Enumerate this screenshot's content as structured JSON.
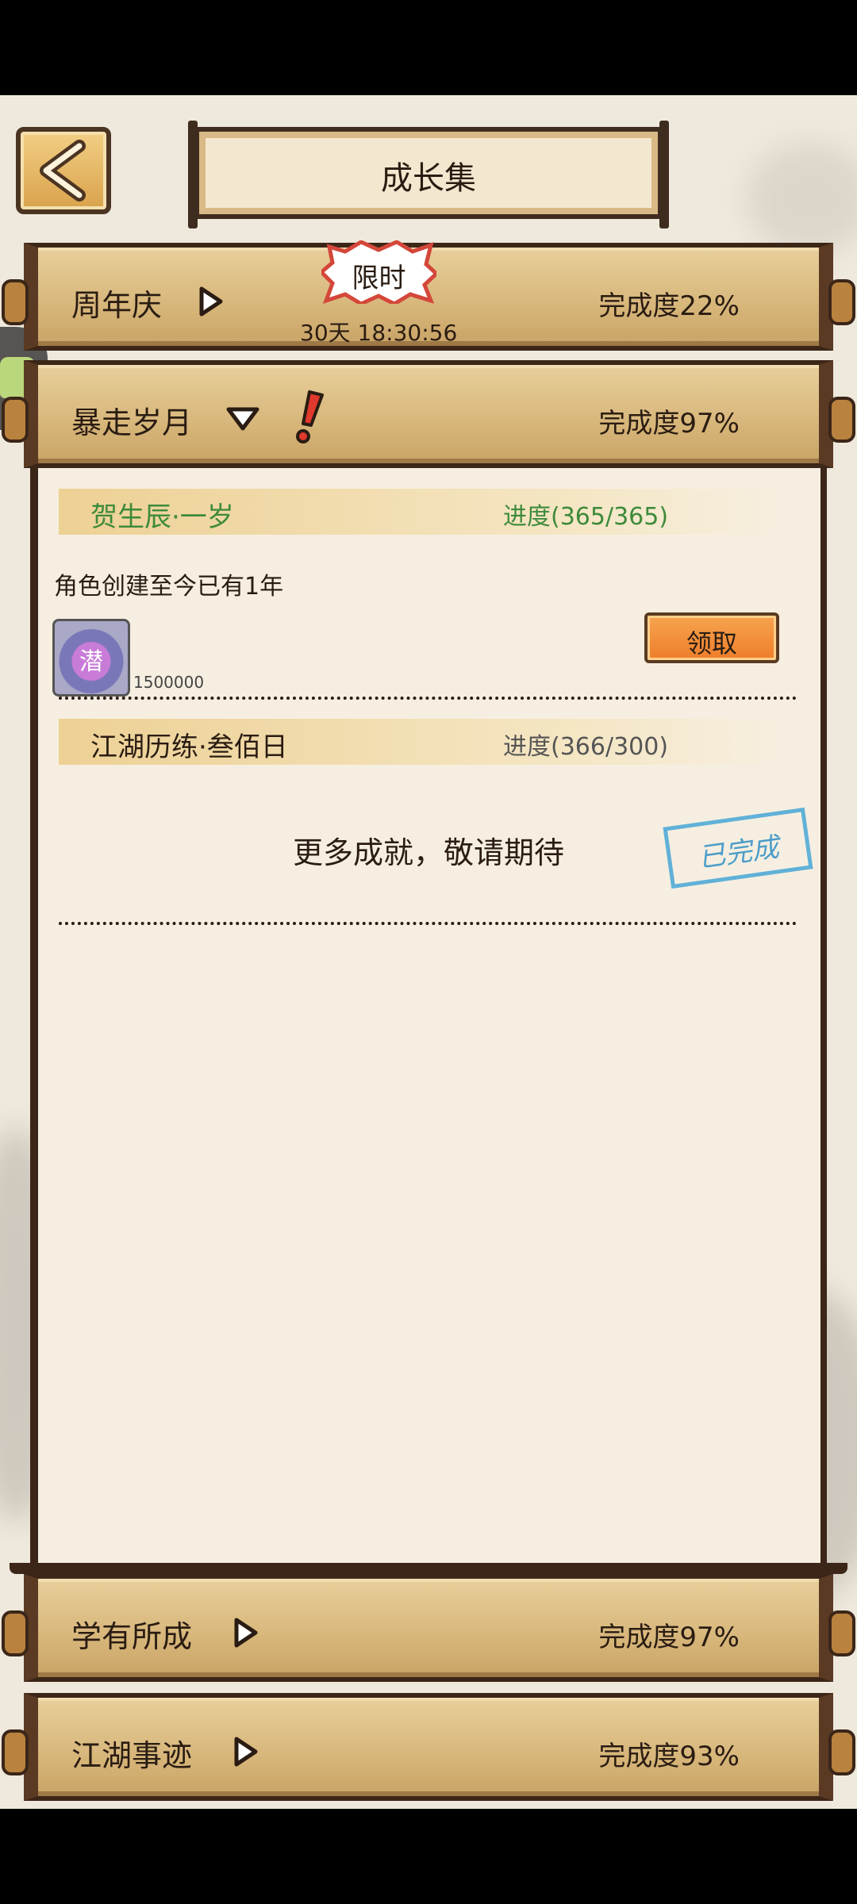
{
  "header": {
    "title": "成长集",
    "back_icon": "chevron-left-icon"
  },
  "categories": [
    {
      "name": "周年庆",
      "progress": "完成度22%",
      "badge": "限时",
      "countdown": "30天 18:30:56",
      "state": "collapsed"
    },
    {
      "name": "暴走岁月",
      "progress": "完成度97%",
      "state": "expanded",
      "alert_icon": "exclamation-icon"
    },
    {
      "name": "学有所成",
      "progress": "完成度97%",
      "state": "collapsed"
    },
    {
      "name": "江湖事迹",
      "progress": "完成度93%",
      "state": "collapsed"
    }
  ],
  "achievements": [
    {
      "name": "贺生辰·一岁",
      "progress": "进度(365/365)",
      "description": "角色创建至今已有1年",
      "reward_qty": "1500000",
      "reward_glyph": "潜",
      "claim_label": "领取"
    },
    {
      "name": "江湖历练·叁佰日",
      "progress": "进度(366/300)",
      "stamp": "已完成"
    }
  ],
  "more_text": "更多成就，敬请期待",
  "colors": {
    "claim": "#ee7d2a",
    "progress_done": "#3d8a3a",
    "stamp": "#46a7d7"
  }
}
